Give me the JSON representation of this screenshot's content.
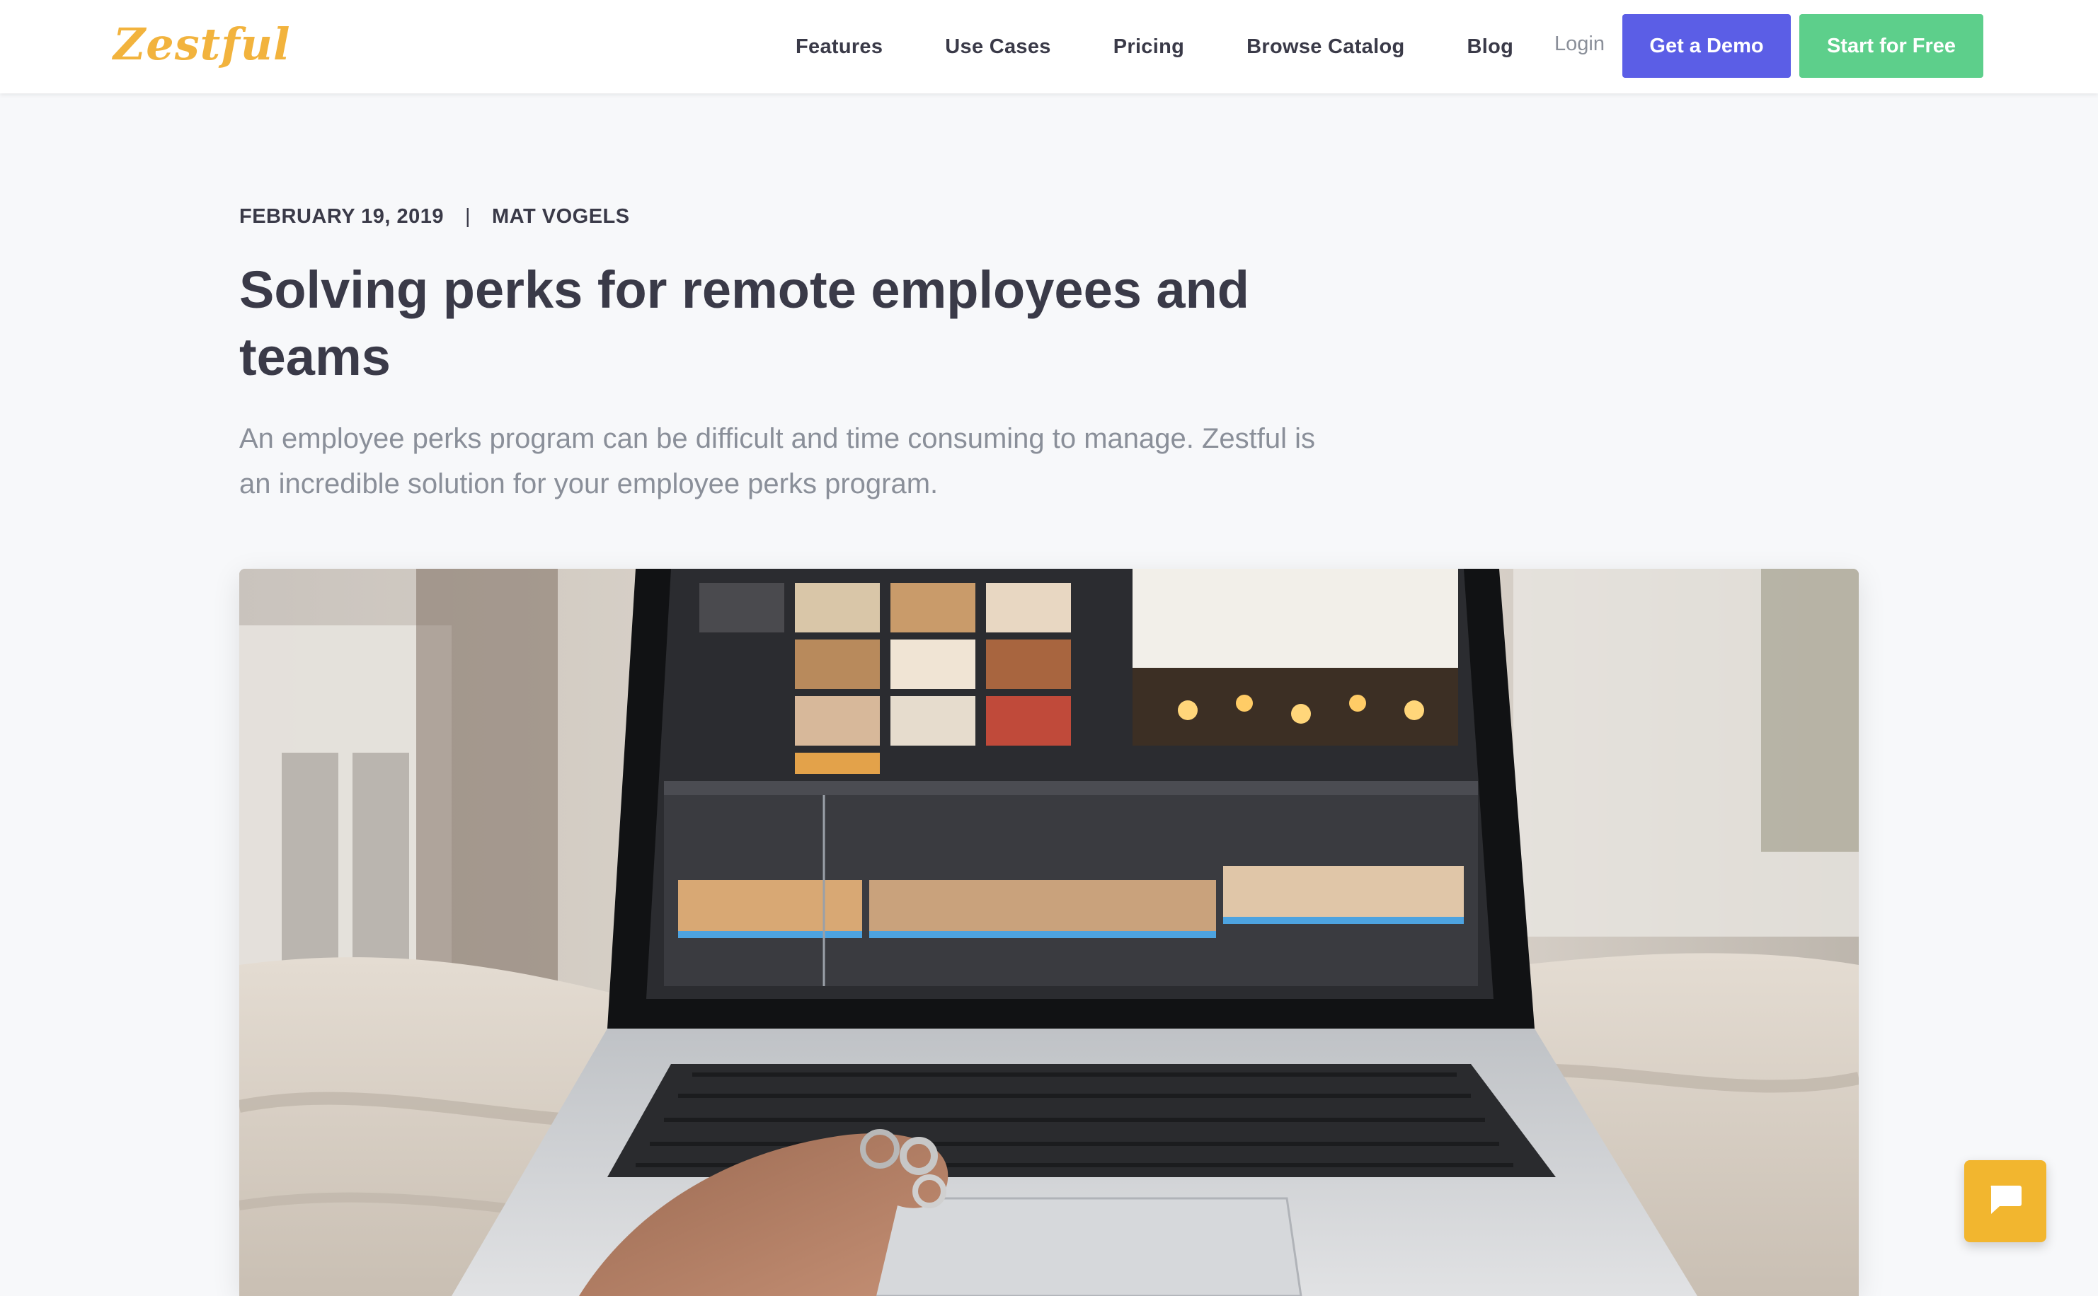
{
  "header": {
    "logo_text": "Zestful",
    "nav": [
      {
        "label": "Features"
      },
      {
        "label": "Use Cases"
      },
      {
        "label": "Pricing"
      },
      {
        "label": "Browse Catalog"
      },
      {
        "label": "Blog"
      }
    ],
    "login_label": "Login",
    "demo_label": "Get a Demo",
    "free_label": "Start for Free"
  },
  "article": {
    "date": "FEBRUARY 19, 2019",
    "separator": "|",
    "author": "MAT VOGELS",
    "title": "Solving perks for remote employees and teams",
    "subtitle": "An employee perks program can be difficult and time consuming to manage. Zestful is an incredible solution for your employee perks program.",
    "hero_image": "laptop-photo"
  },
  "chat": {
    "icon": "chat-bubble-icon"
  },
  "colors": {
    "brand_yellow": "#f2b33d",
    "demo_button": "#5b5ee6",
    "free_button": "#5dcf8b",
    "text_dark": "#3a3a48",
    "text_muted": "#8a8f99",
    "page_bg": "#f7f8fa"
  }
}
